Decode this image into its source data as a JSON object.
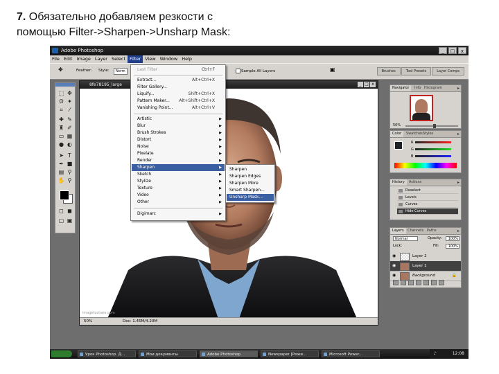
{
  "caption": {
    "number": "7.",
    "line1": "Обязательно добавляем резкости с",
    "line2": "помощью Filter->Sharpen->Unsharp Mask:"
  },
  "app": {
    "title": "Adobe Photoshop",
    "window_buttons": [
      "_",
      "□",
      "x"
    ]
  },
  "menubar": [
    "File",
    "Edit",
    "Image",
    "Layer",
    "Select",
    "Filter",
    "View",
    "Window",
    "Help"
  ],
  "options": {
    "feather_label": "Feather:",
    "style_label": "Style:",
    "style_value": "Norm",
    "sample_all_layers": "Sample All Layers",
    "tabs": [
      "Brushes",
      "Tool Presets",
      "Layer Comps"
    ]
  },
  "document": {
    "title": "8fe78195_large",
    "zoom": "50%",
    "doc_info": "Doc: 1.45M/4.20M",
    "watermark": "imagetoshare.com"
  },
  "filter_menu": {
    "items": [
      {
        "label": "Last Filter",
        "shortcut": "Ctrl+F",
        "disabled": true
      },
      {
        "sep": true
      },
      {
        "label": "Extract...",
        "shortcut": "Alt+Ctrl+X"
      },
      {
        "label": "Filter Gallery..."
      },
      {
        "label": "Liquify...",
        "shortcut": "Shift+Ctrl+X"
      },
      {
        "label": "Pattern Maker...",
        "shortcut": "Alt+Shift+Ctrl+X"
      },
      {
        "label": "Vanishing Point...",
        "shortcut": "Alt+Ctrl+V"
      },
      {
        "sep": true
      },
      {
        "label": "Artistic",
        "submenu": true
      },
      {
        "label": "Blur",
        "submenu": true
      },
      {
        "label": "Brush Strokes",
        "submenu": true
      },
      {
        "label": "Distort",
        "submenu": true
      },
      {
        "label": "Noise",
        "submenu": true
      },
      {
        "label": "Pixelate",
        "submenu": true
      },
      {
        "label": "Render",
        "submenu": true
      },
      {
        "label": "Sharpen",
        "submenu": true,
        "highlighted": true
      },
      {
        "label": "Sketch",
        "submenu": true
      },
      {
        "label": "Stylize",
        "submenu": true
      },
      {
        "label": "Texture",
        "submenu": true
      },
      {
        "label": "Video",
        "submenu": true
      },
      {
        "label": "Other",
        "submenu": true
      },
      {
        "sep": true
      },
      {
        "label": "Digimarc",
        "submenu": true
      }
    ]
  },
  "sharpen_submenu": {
    "items": [
      "Sharpen",
      "Sharpen Edges",
      "Sharpen More",
      "Smart Sharpen...",
      "Unsharp Mask..."
    ],
    "highlighted": "Unsharp Mask..."
  },
  "navigator_panel": {
    "tabs": [
      "Navigator",
      "Info",
      "Histogram"
    ],
    "zoom": "50%"
  },
  "color_panel": {
    "tabs": [
      "Color",
      "Swatches",
      "Styles"
    ],
    "channels": [
      {
        "label": "R",
        "value": "32"
      },
      {
        "label": "G",
        "value": "35"
      },
      {
        "label": "B",
        "value": "37"
      }
    ]
  },
  "history_panel": {
    "tabs": [
      "History",
      "Actions"
    ],
    "items": [
      "Deselect",
      "Levels",
      "Curves",
      "Hide Curves"
    ],
    "selected": "Hide Curves"
  },
  "layers_panel": {
    "tabs": [
      "Layers",
      "Channels",
      "Paths"
    ],
    "blend_mode": "Normal",
    "opacity_label": "Opacity:",
    "opacity_value": "100%",
    "lock_label": "Lock:",
    "fill_label": "Fill:",
    "fill_value": "100%",
    "layers": [
      {
        "name": "Layer 2",
        "selected": false
      },
      {
        "name": "Layer 1",
        "selected": true
      },
      {
        "name": "Background",
        "selected": false
      }
    ]
  },
  "taskbar": {
    "buttons": [
      "Урок Photoshop. Д...",
      "Мои документы",
      "Adobe Photoshop",
      "Newspaper [Режи...",
      "Microsoft Power..."
    ],
    "active": "Adobe Photoshop",
    "clock": "12:08"
  },
  "colors": {
    "menu_highlight": "#3b5fa3",
    "title_bar": "#1c1c1c",
    "chrome": "#d6d3ce",
    "workspace": "#6e6e6e"
  }
}
